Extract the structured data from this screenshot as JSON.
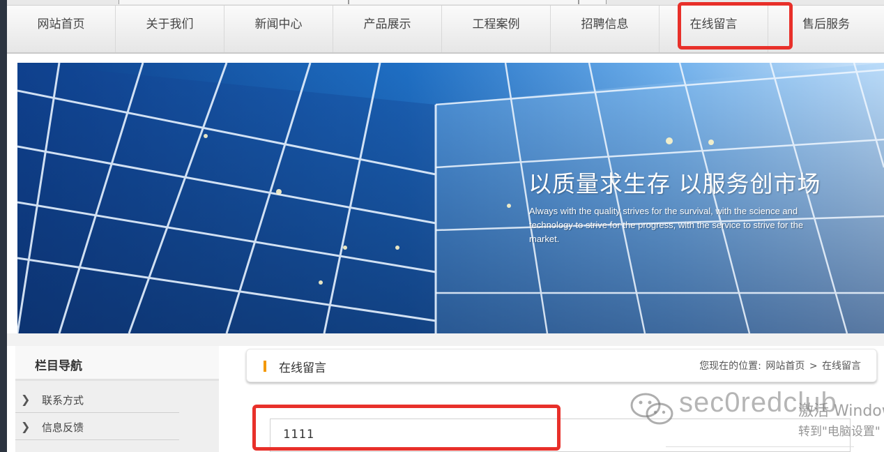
{
  "nav": {
    "items": [
      "网站首页",
      "关于我们",
      "新闻中心",
      "产品展示",
      "工程案例",
      "招聘信息",
      "在线留言",
      "售后服务"
    ]
  },
  "banner": {
    "slogan": "以质量求生存 以服务创市场",
    "slogan_en": "Always with the quality strives for the survival, with the science and technology to strive for the progress, with the service to strive for the market."
  },
  "sidebar": {
    "title": "栏目导航",
    "items": [
      "联系方式",
      "信息反馈"
    ]
  },
  "content": {
    "title": "在线留言",
    "breadcrumb_prefix": "您现在的位置:",
    "breadcrumb_home": "网站首页",
    "breadcrumb_sep": ">",
    "breadcrumb_current": "在线留言",
    "message_value": "1111"
  },
  "overlay": {
    "watermark": "sec0redclub",
    "activate_line1": "激活 Windows",
    "activate_line2": "转到\"电脑设置\""
  },
  "colors": {
    "highlight": "#e8302a",
    "accent": "#f39800",
    "banner_blue": "#1f6fc4"
  }
}
